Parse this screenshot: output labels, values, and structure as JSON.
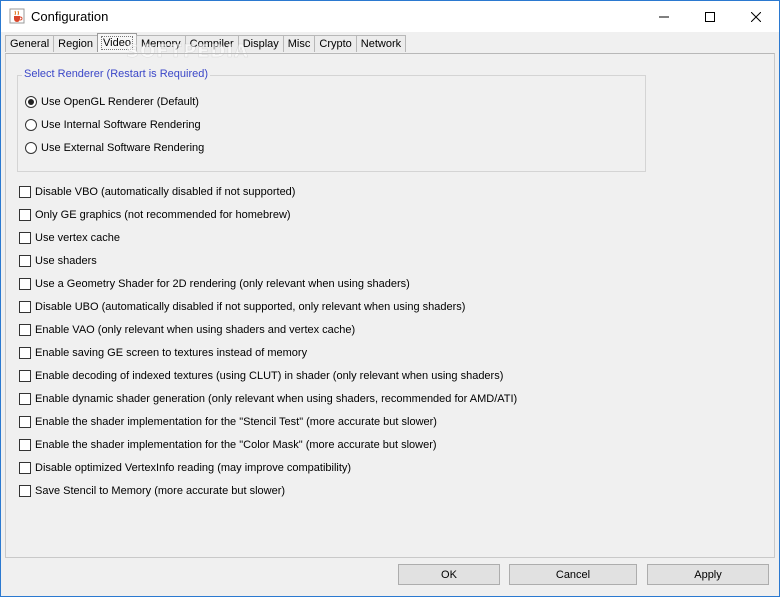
{
  "window": {
    "title": "Configuration",
    "icon": "java-cup-icon"
  },
  "tabs": [
    {
      "label": "General",
      "active": false
    },
    {
      "label": "Region",
      "active": false
    },
    {
      "label": "Video",
      "active": true
    },
    {
      "label": "Memory",
      "active": false
    },
    {
      "label": "Compiler",
      "active": false
    },
    {
      "label": "Display",
      "active": false
    },
    {
      "label": "Misc",
      "active": false
    },
    {
      "label": "Crypto",
      "active": false
    },
    {
      "label": "Network",
      "active": false
    }
  ],
  "renderer_group": {
    "title": "Select Renderer (Restart is Required)",
    "options": [
      {
        "label": "Use OpenGL Renderer (Default)",
        "selected": true
      },
      {
        "label": "Use Internal Software Rendering",
        "selected": false
      },
      {
        "label": "Use External Software Rendering",
        "selected": false
      }
    ]
  },
  "options": [
    {
      "label": "Disable VBO (automatically disabled if not supported)",
      "checked": false
    },
    {
      "label": "Only GE graphics (not recommended for homebrew)",
      "checked": false
    },
    {
      "label": "Use vertex cache",
      "checked": false
    },
    {
      "label": "Use shaders",
      "checked": false
    },
    {
      "label": "Use a Geometry Shader for 2D rendering (only relevant when using shaders)",
      "checked": false
    },
    {
      "label": "Disable UBO (automatically disabled if not supported, only relevant when using shaders)",
      "checked": false
    },
    {
      "label": "Enable VAO (only relevant when using shaders and vertex cache)",
      "checked": false
    },
    {
      "label": "Enable saving GE screen to textures instead of memory",
      "checked": false
    },
    {
      "label": "Enable decoding of indexed textures (using CLUT) in shader (only relevant when using shaders)",
      "checked": false
    },
    {
      "label": "Enable dynamic shader generation (only relevant when using shaders, recommended for AMD/ATI)",
      "checked": false
    },
    {
      "label": "Enable the shader implementation for the \"Stencil Test\" (more accurate but slower)",
      "checked": false
    },
    {
      "label": "Enable the shader implementation for the \"Color Mask\" (more accurate but slower)",
      "checked": false
    },
    {
      "label": "Disable optimized VertexInfo reading (may improve compatibility)",
      "checked": false
    },
    {
      "label": "Save Stencil to Memory (more accurate but slower)",
      "checked": false
    }
  ],
  "buttons": {
    "ok": "OK",
    "cancel": "Cancel",
    "apply": "Apply"
  },
  "watermark": "SOFTPEDIA"
}
